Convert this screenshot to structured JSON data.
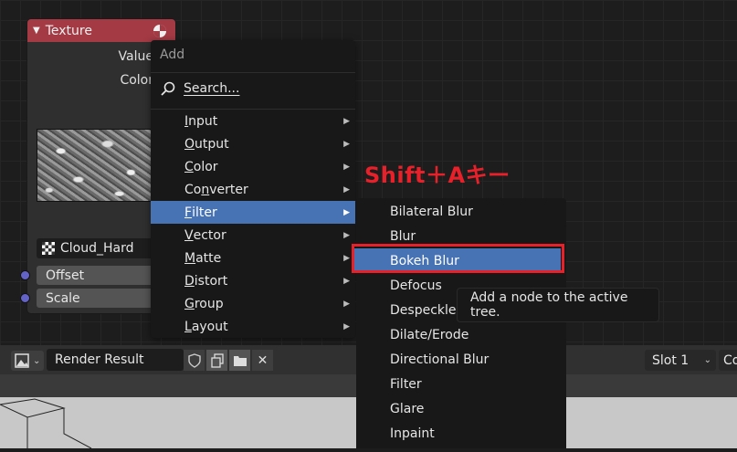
{
  "node": {
    "title": "Texture",
    "outputs": [
      "Value",
      "Color"
    ],
    "texture_name": "Cloud_Hard",
    "inputs": [
      "Offset",
      "Scale"
    ],
    "header_color": "#a33a44"
  },
  "add_menu": {
    "title": "Add",
    "search_label": "Search...",
    "items": [
      {
        "label": "Input",
        "underline": "I",
        "rest": "nput"
      },
      {
        "label": "Output",
        "underline": "O",
        "rest": "utput"
      },
      {
        "label": "Color",
        "underline": "C",
        "rest": "olor"
      },
      {
        "label": "Converter",
        "pre": "Co",
        "underline": "n",
        "rest": "verter"
      },
      {
        "label": "Filter",
        "underline": "F",
        "rest": "ilter"
      },
      {
        "label": "Vector",
        "underline": "V",
        "rest": "ector"
      },
      {
        "label": "Matte",
        "underline": "M",
        "rest": "atte"
      },
      {
        "label": "Distort",
        "underline": "D",
        "rest": "istort"
      },
      {
        "label": "Group",
        "underline": "G",
        "rest": "roup"
      },
      {
        "label": "Layout",
        "underline": "L",
        "rest": "ayout"
      }
    ],
    "active_item": "Filter"
  },
  "filter_submenu": {
    "items": [
      "Bilateral Blur",
      "Blur",
      "Bokeh Blur",
      "Defocus",
      "Despeckle",
      "Dilate/Erode",
      "Directional Blur",
      "Filter",
      "Glare",
      "Inpaint"
    ],
    "active_item": "Bokeh Blur"
  },
  "annotation": "Shift＋Aキー",
  "tooltip": "Add a node to the active tree.",
  "image_editor": {
    "image_name": "Render Result",
    "slot": "Slot 1",
    "cut_label": "Co"
  },
  "colors": {
    "accent": "#4772b3",
    "highlight_box": "#e8202a"
  }
}
